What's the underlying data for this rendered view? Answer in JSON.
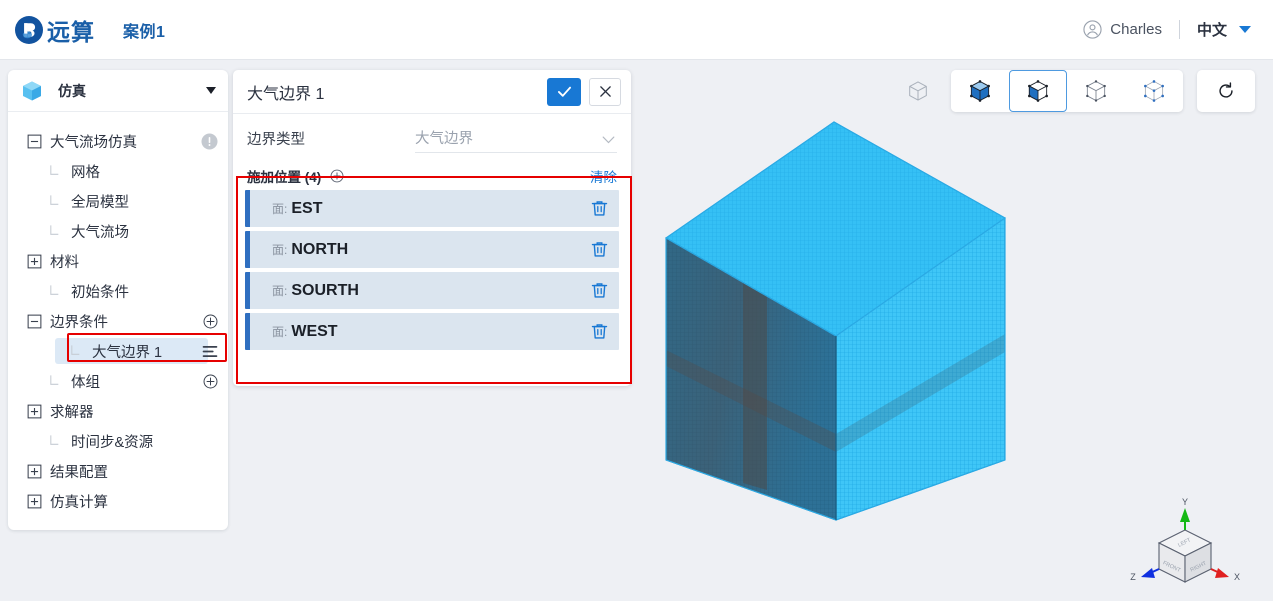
{
  "header": {
    "logo_icon": "yuansuan-logo-icon",
    "logo_text": "远算",
    "project_name": "案例1",
    "user_icon": "user-circle-icon",
    "user_name": "Charles",
    "language_label": "中文",
    "language_caret_icon": "caret-down-icon"
  },
  "sidebar": {
    "header": {
      "icon": "cube-icon",
      "label": "仿真",
      "caret_icon": "caret-down-icon"
    },
    "tree": [
      {
        "label": "大气流场仿真",
        "toggle": "minus-box-icon",
        "indent": 0,
        "action": "info-icon"
      },
      {
        "label": "网格",
        "toggle": "tree-branch",
        "indent": 1,
        "action": ""
      },
      {
        "label": "全局模型",
        "toggle": "tree-branch",
        "indent": 1,
        "action": ""
      },
      {
        "label": "大气流场",
        "toggle": "tree-branch",
        "indent": 1,
        "action": ""
      },
      {
        "label": "材料",
        "toggle": "plus-box-icon",
        "indent": 0,
        "action": ""
      },
      {
        "label": "初始条件",
        "toggle": "tree-branch",
        "indent": 1,
        "action": ""
      },
      {
        "label": "边界条件",
        "toggle": "minus-box-icon",
        "indent": 0,
        "action": "plus-circle-icon"
      },
      {
        "label": "大气边界 1",
        "toggle": "tree-branch",
        "indent": 2,
        "action": "list-menu-icon",
        "selected": true
      },
      {
        "label": "体组",
        "toggle": "tree-branch",
        "indent": 1,
        "action": "plus-circle-icon"
      },
      {
        "label": "求解器",
        "toggle": "plus-box-icon",
        "indent": 0,
        "action": ""
      },
      {
        "label": "时间步&资源",
        "toggle": "tree-branch",
        "indent": 1,
        "action": ""
      },
      {
        "label": "结果配置",
        "toggle": "plus-box-icon",
        "indent": 0,
        "action": ""
      },
      {
        "label": "仿真计算",
        "toggle": "plus-box-icon",
        "indent": 0,
        "action": ""
      }
    ]
  },
  "panel": {
    "title": "大气边界 1",
    "confirm_icon": "check-icon",
    "cancel_icon": "close-icon",
    "boundary_type": {
      "label": "边界类型",
      "value": "大气边界",
      "caret_icon": "chevron-down-icon"
    },
    "locations": {
      "title": "施加位置 (4)",
      "count": 4,
      "add_icon": "plus-circle-icon",
      "clear_label": "清除",
      "items": [
        {
          "prefix": "面:",
          "name": "EST",
          "delete_icon": "trash-icon"
        },
        {
          "prefix": "面:",
          "name": "NORTH",
          "delete_icon": "trash-icon"
        },
        {
          "prefix": "面:",
          "name": "SOURTH",
          "delete_icon": "trash-icon"
        },
        {
          "prefix": "面:",
          "name": "WEST",
          "delete_icon": "trash-icon"
        }
      ]
    }
  },
  "viewbar": {
    "buttons": [
      {
        "name": "wireframe-cube-icon",
        "active": false,
        "grouped": false
      },
      {
        "name": "solid-cube-icon",
        "active": false,
        "grouped": true
      },
      {
        "name": "half-solid-cube-icon",
        "active": true,
        "grouped": true
      },
      {
        "name": "outline-cube-icon",
        "active": false,
        "grouped": true
      },
      {
        "name": "points-cube-icon",
        "active": false,
        "grouped": true
      },
      {
        "name": "reset-view-icon",
        "active": false,
        "grouped": false
      }
    ]
  },
  "viewport": {
    "model": "meshed-cuboid-model",
    "axis_gizmo": {
      "x_label": "X",
      "y_label": "Y",
      "z_label": "Z",
      "face_top": "LEFT",
      "face_left": "FRONT",
      "face_right": "RIGHT",
      "x_color": "#e02020",
      "y_color": "#14b814",
      "z_color": "#1030e0"
    }
  },
  "annotations": {
    "highlight_color": "#e60000"
  },
  "colors": {
    "accent": "#1878d4",
    "brand": "#1a5fa8",
    "row_bg": "#dbe5ef",
    "row_accent": "#2f6fc0",
    "page_bg": "#eef0f4"
  }
}
